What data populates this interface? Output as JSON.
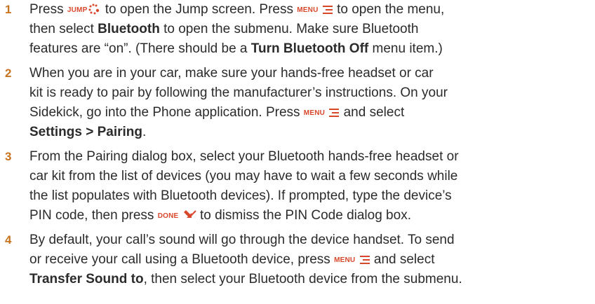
{
  "keys": {
    "jump": "JUMP",
    "menu": "MENU",
    "done": "DONE"
  },
  "accent_colors": {
    "step_number": "#c8741f",
    "key_label": "#d9472b"
  },
  "steps": [
    {
      "number": "1",
      "l1a": "Press ",
      "l1b": " to open the Jump screen. Press ",
      "l1c": " to open the menu,",
      "l2a": "then select ",
      "l2b": "Bluetooth",
      "l2c": " to open the submenu. Make sure Bluetooth",
      "l3a": "features are “on”. (There should be a ",
      "l3b": "Turn Bluetooth Off",
      "l3c": " menu item.)"
    },
    {
      "number": "2",
      "l1": "When you are in your car, make sure your hands-free headset or car",
      "l2": "kit is ready to pair by following the manufacturer’s instructions. On your",
      "l3a": "Sidekick, go into the Phone application. Press ",
      "l3b": " and select",
      "l4": "Settings > Pairing",
      "l4end": "."
    },
    {
      "number": "3",
      "l1": "From the Pairing dialog box, select your Bluetooth hands-free headset or",
      "l2": "car kit from the list of devices (you may have to wait a few seconds while",
      "l3": "the list populates with Bluetooth devices). If prompted, type the device’s",
      "l4a": "PIN code, then press ",
      "l4b": " to dismiss the PIN Code dialog box."
    },
    {
      "number": "4",
      "l1": "By default, your call’s sound will go through the device handset. To send",
      "l2a": "or receive your call using a Bluetooth device, press ",
      "l2b": " and select",
      "l3a": "Transfer Sound to",
      "l3b": ", then select your Bluetooth device from the submenu."
    }
  ]
}
